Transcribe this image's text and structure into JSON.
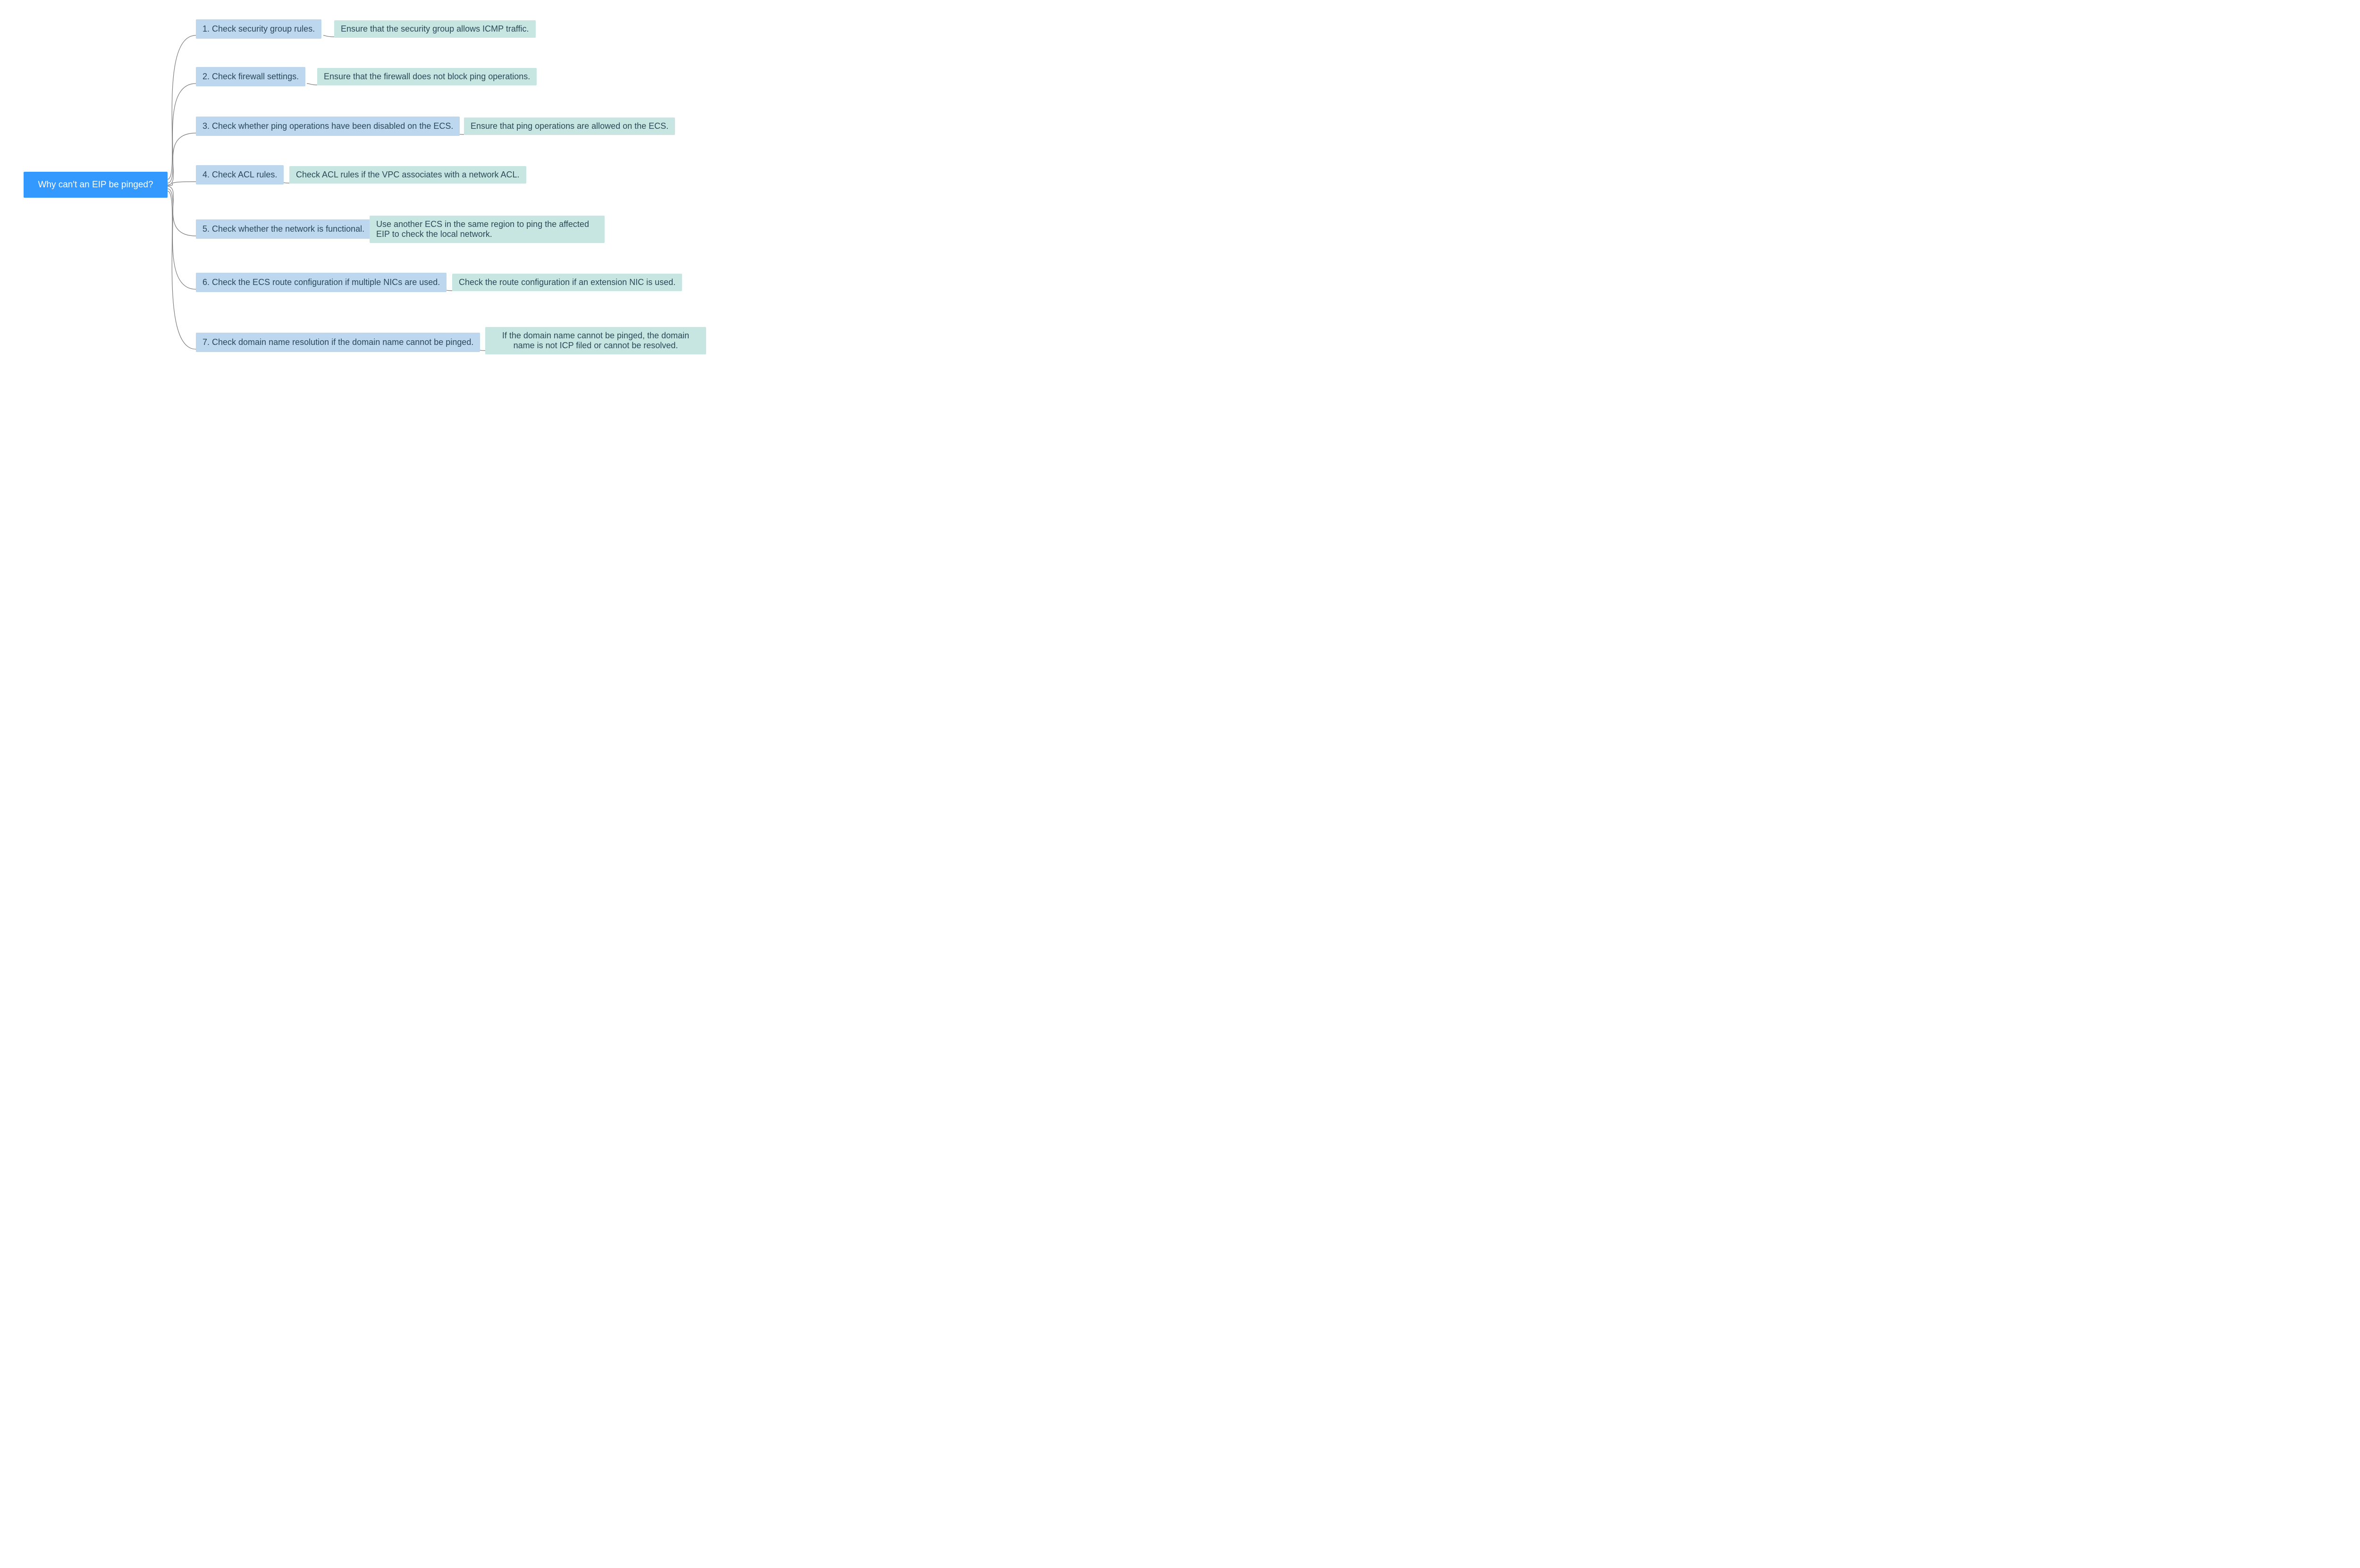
{
  "root": "Why can't an EIP be pinged?",
  "steps": [
    {
      "label": "1. Check security group rules.",
      "detail": "Ensure that the security group allows ICMP traffic."
    },
    {
      "label": "2. Check firewall settings.",
      "detail": "Ensure that the firewall does not block ping operations."
    },
    {
      "label": "3. Check whether ping operations have been disabled on the ECS.",
      "detail": "Ensure that ping operations are allowed on the ECS."
    },
    {
      "label": "4. Check ACL rules.",
      "detail": "Check ACL rules if the VPC associates with a network ACL."
    },
    {
      "label": "5. Check whether the network is functional.",
      "detail": "Use another ECS in the same region to ping the affected EIP to check the local network."
    },
    {
      "label": "6. Check the ECS route configuration if multiple NICs are used.",
      "detail": "Check the route configuration if an extension NIC is used."
    },
    {
      "label": "7. Check domain name resolution if the domain name cannot be pinged.",
      "detail": "If the domain name cannot be pinged, the domain name is not ICP filed or cannot be resolved."
    }
  ]
}
